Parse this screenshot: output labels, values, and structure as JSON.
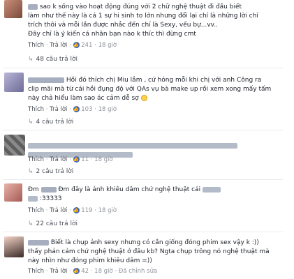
{
  "c1": {
    "lines": [
      "sao k sống vào hoạt động đúng với 2 chữ nghệ thuật đi đầu biết",
      "làm như thế này là cả 1 sự hi sinh to lớn nhưng đổi lại chỉ là những lời chỉ",
      "trích thôi và mỗi lần được nhắc đến chỉ là Sexy, vếu bự...vv..",
      "Đây chỉ là ý kiến cá nhân bạn nào k thíc thì đừng cmt"
    ],
    "like": "Thích",
    "reply": "Trả lời",
    "count": "241",
    "time": "18 giờ",
    "replies": "48 câu trả lời"
  },
  "c2": {
    "lines": [
      "Hồi đó thích chị Miu lắm , cứ hóng mỗi khi chị với anh Công ra",
      "clip mãi mà từ cái hồi đụng độ với QAs vụ bà make up rồi xem xong mấy tấm",
      "này chả hiểu làm sao ác cảm dễ sợ"
    ],
    "like": "Thích",
    "reply": "Trả lời",
    "count": "103",
    "time": "18 giờ",
    "replies": "4 câu trả lời"
  },
  "c3": {
    "like": "Thích",
    "reply": "Trả lời",
    "count": "11",
    "time": "18 giờ",
    "replies": "2 câu trả lời"
  },
  "c4": {
    "line1_a": "Đm",
    "line1_b": "Đm đây là ảnh khiêu dâm chứ nghệ thuật cái",
    "line2": ":33333",
    "like": "Thích",
    "reply": "Trả lời",
    "count": "119",
    "time": "18 giờ",
    "replies": "22 câu trả lời"
  },
  "c5": {
    "lines": [
      "Biết là chụp ảnh sexy nhưng có cần giống đóng phim sex vậy k :))",
      "thấy phản cảm chứ nghệ thuật ở đâu kb? Ngta chụp trông nó nghệ thuật mà",
      "này nhìn như đóng phim khiêu dâm =))"
    ],
    "like": "Thích",
    "reply": "Trả lời",
    "count": "42",
    "time": "18 giờ",
    "edited": "Đã chỉnh sửa"
  },
  "colors": {
    "link": "#4b4f56",
    "meta": "#90949c",
    "like_blue": "#4267b2",
    "divider": "#e9ebee"
  },
  "icons": [
    "like-reaction-icon",
    "reply-arrow-icon",
    "smile-emoji-icon"
  ]
}
